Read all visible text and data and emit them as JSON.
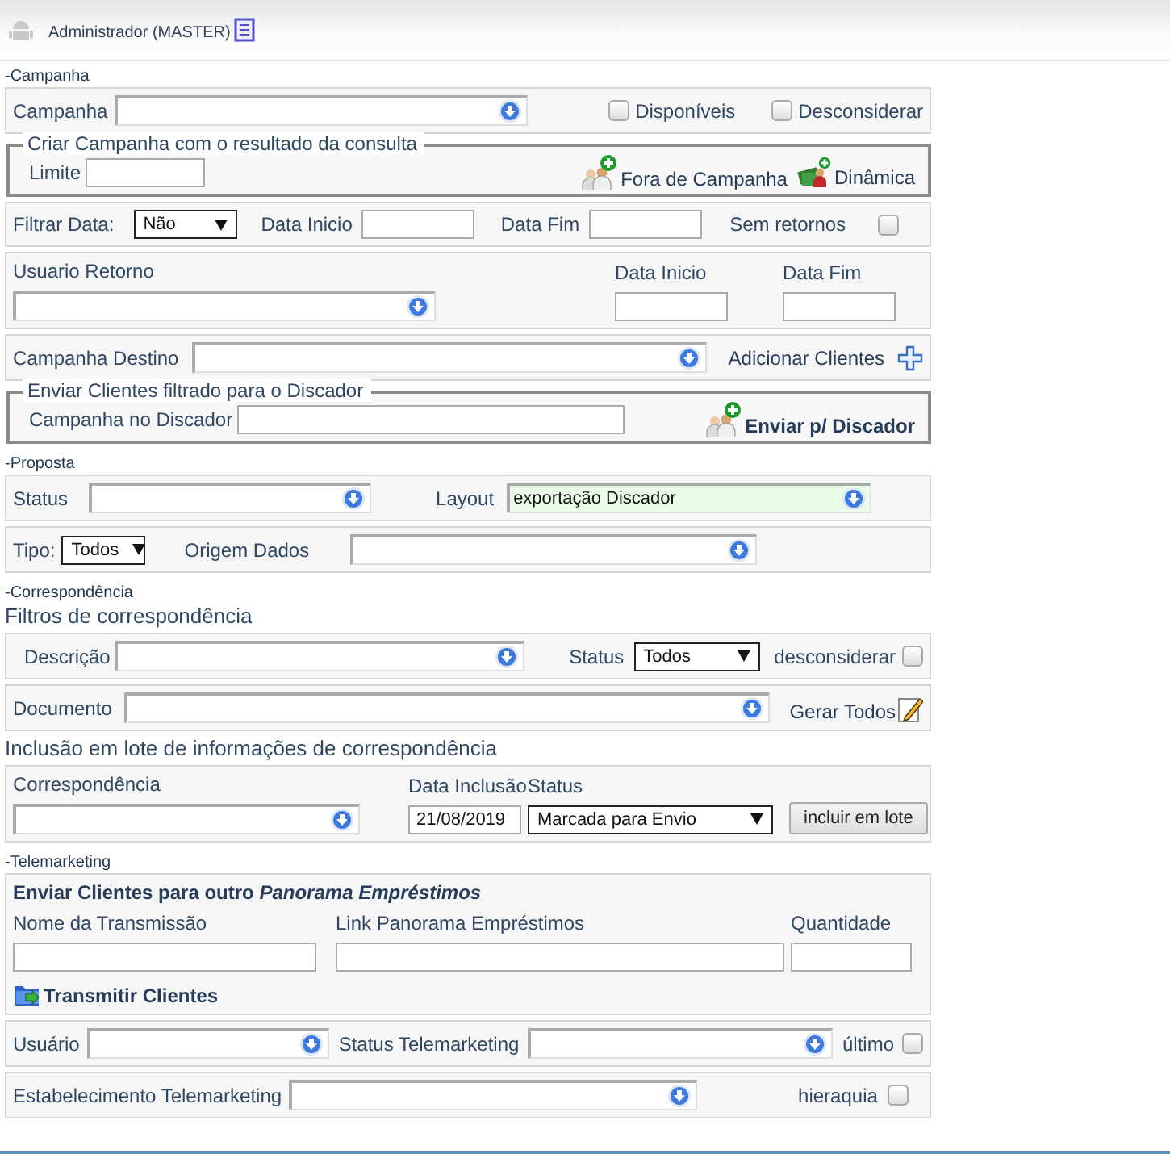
{
  "header": {
    "user": "Administrador (MASTER)"
  },
  "sections": [
    {
      "title": "-Campanha",
      "blocks": [
        {
          "kind": "panel",
          "items": [
            {
              "kind": "label",
              "text": "Campanha"
            },
            {
              "kind": "combo"
            },
            {
              "kind": "checkbox",
              "text": "Disponíveis",
              "checked": false
            },
            {
              "kind": "checkbox",
              "text": "Desconsiderar",
              "checked": false
            }
          ]
        },
        {
          "kind": "fieldset",
          "legend": "Criar Campanha com o resultado da consulta",
          "items": [
            {
              "kind": "label",
              "text": "Limite"
            },
            {
              "kind": "input"
            },
            {
              "kind": "people_link",
              "text": "Fora de Campanha"
            },
            {
              "kind": "cash_link",
              "text": "Dinâmica"
            }
          ]
        },
        {
          "kind": "panel",
          "items": [
            {
              "kind": "label",
              "text": "Filtrar Data:"
            },
            {
              "kind": "select",
              "value": "Não"
            },
            {
              "kind": "label",
              "text": "Data Inicio"
            },
            {
              "kind": "input"
            },
            {
              "kind": "label",
              "text": "Data Fim"
            },
            {
              "kind": "input"
            },
            {
              "kind": "label",
              "text": "Sem retornos"
            },
            {
              "kind": "checkbox",
              "checked": false
            }
          ]
        },
        {
          "kind": "panel",
          "items": [
            {
              "kind": "stack",
              "label": "Usuario Retorno",
              "control": {
                "kind": "combo"
              }
            },
            {
              "kind": "stack",
              "label": "Data Inicio",
              "control": {
                "kind": "input"
              }
            },
            {
              "kind": "stack",
              "label": "Data Fim",
              "control": {
                "kind": "input"
              }
            }
          ]
        },
        {
          "kind": "panel",
          "items": [
            {
              "kind": "label",
              "text": "Campanha Destino"
            },
            {
              "kind": "combo"
            },
            {
              "kind": "add_link",
              "text": "Adicionar Clientes"
            }
          ]
        },
        {
          "kind": "fieldset",
          "legend": "Enviar Clientes filtrado para o Discador",
          "items": [
            {
              "kind": "label",
              "text": "Campanha no Discador"
            },
            {
              "kind": "input"
            },
            {
              "kind": "people_link",
              "text": "Enviar p/ Discador"
            }
          ]
        }
      ]
    },
    {
      "title": "-Proposta",
      "blocks": [
        {
          "kind": "panel",
          "items": [
            {
              "kind": "label",
              "text": "Status"
            },
            {
              "kind": "combo"
            },
            {
              "kind": "label",
              "text": "Layout"
            },
            {
              "kind": "combo",
              "value": "exportação Discador"
            }
          ]
        },
        {
          "kind": "panel",
          "items": [
            {
              "kind": "label",
              "text": "Tipo:"
            },
            {
              "kind": "select",
              "value": "Todos"
            },
            {
              "kind": "label",
              "text": "Origem Dados"
            },
            {
              "kind": "combo"
            }
          ]
        }
      ]
    },
    {
      "title": "-Correspondência",
      "blocks": [
        {
          "kind": "heading",
          "text": "Filtros de correspondência"
        },
        {
          "kind": "panel",
          "items": [
            {
              "kind": "label",
              "text": "Descrição"
            },
            {
              "kind": "combo"
            },
            {
              "kind": "label",
              "text": "Status"
            },
            {
              "kind": "select",
              "value": "Todos"
            },
            {
              "kind": "label",
              "text": "desconsiderar"
            },
            {
              "kind": "checkbox",
              "checked": false
            }
          ]
        },
        {
          "kind": "panel",
          "items": [
            {
              "kind": "label",
              "text": "Documento"
            },
            {
              "kind": "combo"
            },
            {
              "kind": "edit_link",
              "text": "Gerar Todos"
            }
          ]
        },
        {
          "kind": "heading",
          "text": "Inclusão em lote de informações de correspondência"
        },
        {
          "kind": "panel",
          "items": [
            {
              "kind": "stack",
              "label": "Correspondência",
              "control": {
                "kind": "combo"
              }
            },
            {
              "kind": "stack",
              "label": "Data Inclusão",
              "control": {
                "kind": "input",
                "value": "21/08/2019"
              }
            },
            {
              "kind": "stack",
              "label": "Status",
              "control": {
                "kind": "select",
                "value": "Marcada para Envio"
              }
            },
            {
              "kind": "button",
              "text": "incluir em lote"
            }
          ]
        }
      ]
    },
    {
      "title": "-Telemarketing",
      "blocks": [
        {
          "kind": "panel",
          "items": [
            {
              "kind": "title",
              "text": "Enviar Clientes para outro *Panorama Empréstimos*"
            },
            {
              "kind": "stack",
              "label": "Nome da Transmissão",
              "control": {
                "kind": "input"
              }
            },
            {
              "kind": "stack",
              "label": "Link Panorama Empréstimos",
              "control": {
                "kind": "input"
              }
            },
            {
              "kind": "stack",
              "label": "Quantidade",
              "control": {
                "kind": "input"
              }
            },
            {
              "kind": "folder_link",
              "text": "Transmitir Clientes"
            }
          ]
        },
        {
          "kind": "panel",
          "items": [
            {
              "kind": "label",
              "text": "Usuário"
            },
            {
              "kind": "combo"
            },
            {
              "kind": "label",
              "text": "Status Telemarketing"
            },
            {
              "kind": "combo"
            },
            {
              "kind": "label",
              "text": "último"
            },
            {
              "kind": "checkbox",
              "checked": false
            }
          ]
        },
        {
          "kind": "panel",
          "items": [
            {
              "kind": "label",
              "text": "Estabelecimento Telemarketing"
            },
            {
              "kind": "combo"
            },
            {
              "kind": "label",
              "text": "hieraquia"
            },
            {
              "kind": "checkbox",
              "checked": false
            }
          ]
        }
      ]
    }
  ]
}
